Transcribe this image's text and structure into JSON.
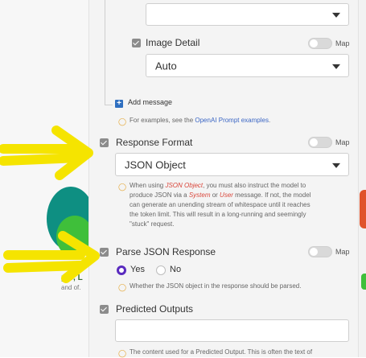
{
  "background": {
    "node_caption": "per, L",
    "node_sub": "and of."
  },
  "image_detail": {
    "label": "Image Detail",
    "map_label": "Map",
    "selected": "Auto"
  },
  "messages": {
    "add_label": "Add message",
    "hint_prefix": "For examples, see the ",
    "hint_link": "OpenAI Prompt examples",
    "hint_suffix": "."
  },
  "response_format": {
    "label": "Response Format",
    "map_label": "Map",
    "selected": "JSON Object",
    "hint_1": "When using ",
    "hint_code_1": "JSON Object",
    "hint_2": ", you must also instruct the model to",
    "hint_line2_a": "produce JSON via a ",
    "hint_code_2": "System",
    "hint_line2_b": " or ",
    "hint_code_3": "User",
    "hint_line2_c": " message. If not, the model",
    "hint_line3": "can generate an unending stream of whitespace until it reaches",
    "hint_line4": "the token limit. This will result in a long-running and seemingly",
    "hint_line5": "\"stuck\" request."
  },
  "parse_json": {
    "label": "Parse JSON Response",
    "map_label": "Map",
    "option_yes": "Yes",
    "option_no": "No",
    "selected": "Yes",
    "hint": "Whether the JSON object in the response should be parsed."
  },
  "predicted_outputs": {
    "label": "Predicted Outputs",
    "value": "",
    "hint": "The content used for a Predicted Output. This is often the text of"
  },
  "colors": {
    "accent_purple": "#5a2bbf",
    "link_blue": "#3b66c4",
    "code_red": "#d9463b",
    "annotation_yellow": "#f5e400"
  }
}
